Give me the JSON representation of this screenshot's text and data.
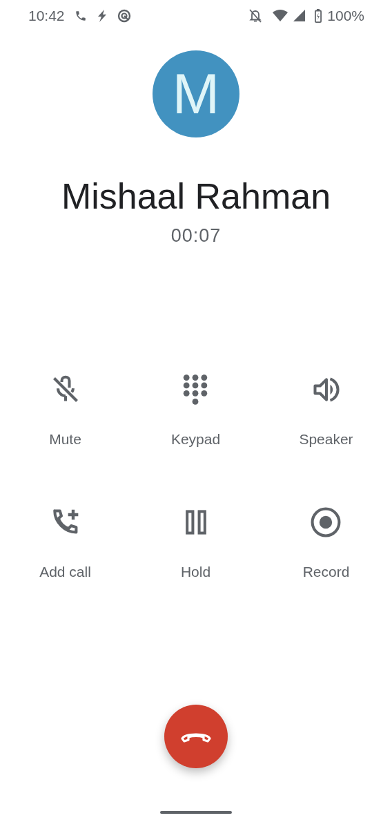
{
  "status_bar": {
    "time": "10:42",
    "battery": "100%"
  },
  "contact": {
    "avatar_letter": "M",
    "name": "Mishaal Rahman",
    "duration": "00:07"
  },
  "actions": [
    {
      "kind": "mute",
      "label": "Mute"
    },
    {
      "kind": "keypad",
      "label": "Keypad"
    },
    {
      "kind": "speaker",
      "label": "Speaker"
    },
    {
      "kind": "add_call",
      "label": "Add call"
    },
    {
      "kind": "hold",
      "label": "Hold"
    },
    {
      "kind": "record",
      "label": "Record"
    }
  ]
}
